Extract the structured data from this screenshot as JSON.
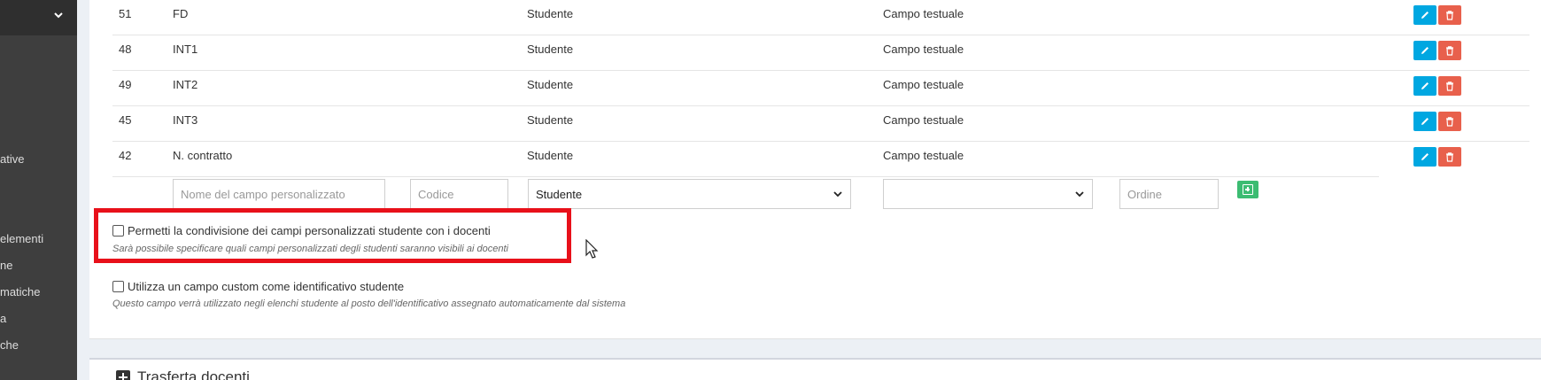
{
  "sidebar": {
    "items": [
      {
        "label": "ative"
      },
      {
        "label": "elementi"
      },
      {
        "label": "ne"
      },
      {
        "label": "matiche"
      },
      {
        "label": "a"
      },
      {
        "label": "che"
      }
    ],
    "toggle_icon": "chevron-down-icon"
  },
  "table": {
    "rows": [
      {
        "id": "51",
        "name": "FD",
        "type": "Studente",
        "kind": "Campo testuale"
      },
      {
        "id": "48",
        "name": "INT1",
        "type": "Studente",
        "kind": "Campo testuale"
      },
      {
        "id": "49",
        "name": "INT2",
        "type": "Studente",
        "kind": "Campo testuale"
      },
      {
        "id": "45",
        "name": "INT3",
        "type": "Studente",
        "kind": "Campo testuale"
      },
      {
        "id": "42",
        "name": "N. contratto",
        "type": "Studente",
        "kind": "Campo testuale"
      }
    ],
    "row_actions": {
      "edit_icon": "pencil-icon",
      "delete_icon": "trash-icon"
    }
  },
  "new_field": {
    "name_placeholder": "Nome del campo personalizzato",
    "code_placeholder": "Codice",
    "type_value": "Studente",
    "kind_value": "",
    "order_placeholder": "Ordine",
    "add_icon": "plus-square-icon"
  },
  "options": {
    "share_label": "Permetti la condivisione dei campi personalizzati studente con i docenti",
    "share_help": "Sarà possibile specificare quali campi personalizzati degli studenti saranno visibili ai docenti",
    "custom_id_label": "Utilizza un campo custom come identificativo studente",
    "custom_id_help": "Questo campo verrà utilizzato negli elenchi studente al posto dell'identificativo assegnato automaticamente dal sistema"
  },
  "next_section": {
    "title": "Trasferta docenti"
  },
  "colors": {
    "sidebar_bg": "#3e3e3e",
    "edit_button": "#00a7e1",
    "delete_button": "#e8604c",
    "add_button": "#3cbc72",
    "highlight": "#e8101a"
  }
}
